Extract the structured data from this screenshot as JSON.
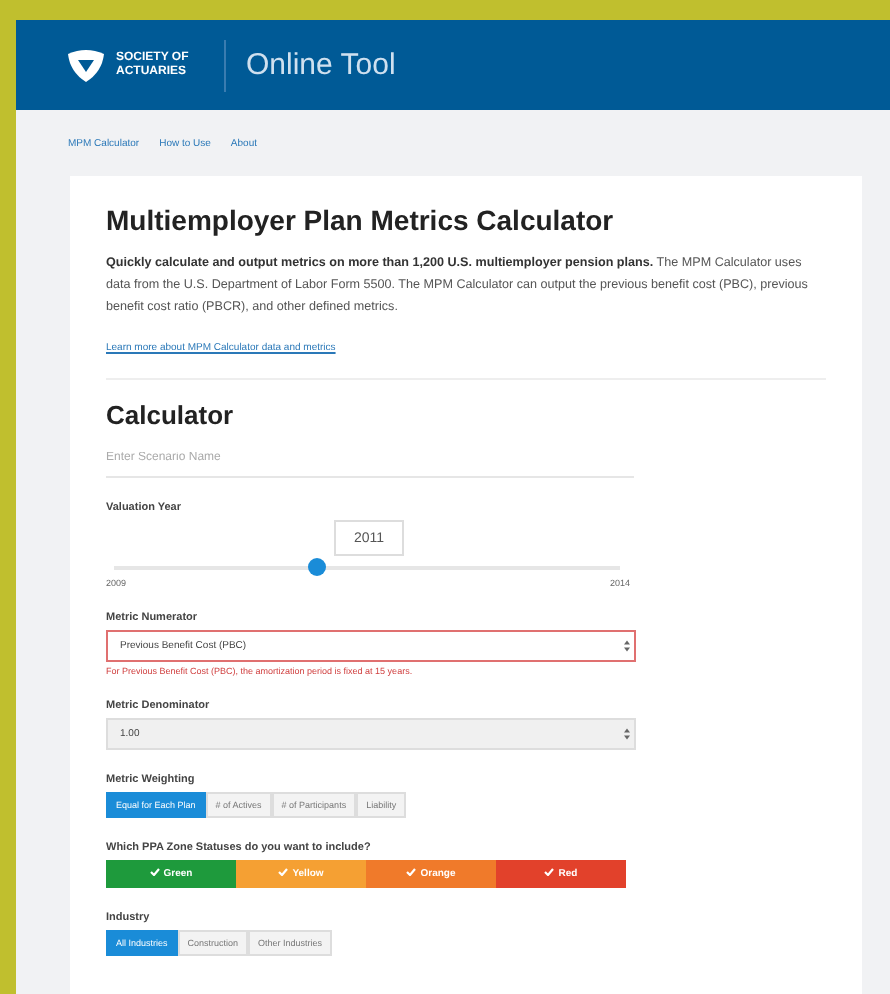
{
  "header": {
    "logo_text": "SOCIETY OF ACTUARIES",
    "title": "Online Tool"
  },
  "nav": [
    {
      "label": "MPM Calculator"
    },
    {
      "label": "How to Use"
    },
    {
      "label": "About"
    }
  ],
  "intro": {
    "heading": "Multiemployer Plan Metrics Calculator",
    "text": "**Quickly calculate and output metrics on more than 1,200 U.S. multiemployer pension plans.** The MPM Calculator uses data from the U.S. Department of Labor Form 5500. The MPM Calculator can output the previous benefit cost (PBC), previous benefit cost ratio (PBCR), and other defined metrics.",
    "link": "Learn more about MPM Calculator data and metrics"
  },
  "calculator": {
    "heading": "Calculator",
    "scenario": {
      "placeholder": "Enter Scenario Name"
    },
    "valuation_year": {
      "label": "Valuation Year",
      "value": "2011",
      "level": 0.4,
      "min": "2009",
      "max": "2014"
    },
    "numerator": {
      "label": "Metric Numerator",
      "value": "Previous Benefit Cost (PBC)",
      "error": "For Previous Benefit Cost (PBC), the amortization period is fixed at 15 years."
    },
    "denominator": {
      "label": "Metric Denominator",
      "value": "1.00",
      "disabled": true
    },
    "weighting": {
      "label": "Metric Weighting",
      "options": [
        {
          "label": "Equal for Each Plan",
          "selected": true
        },
        {
          "label": "# of Actives",
          "selected": false
        },
        {
          "label": "# of Participants",
          "selected": false
        },
        {
          "label": "Liability",
          "selected": false
        }
      ]
    },
    "zones": {
      "label": "Which PPA Zone Statuses do you want to include?",
      "options": [
        {
          "label": "Green",
          "checked": true,
          "color": "#1e9a3c"
        },
        {
          "label": "Yellow",
          "checked": true,
          "color": "#f5a033"
        },
        {
          "label": "Orange",
          "checked": true,
          "color": "#f07a2a"
        },
        {
          "label": "Red",
          "checked": true,
          "color": "#e2412b"
        }
      ]
    },
    "industry": {
      "label": "Industry",
      "options": [
        {
          "label": "All Industries",
          "selected": true
        },
        {
          "label": "Construction",
          "selected": false
        },
        {
          "label": "Other Industries",
          "selected": false
        }
      ]
    }
  }
}
